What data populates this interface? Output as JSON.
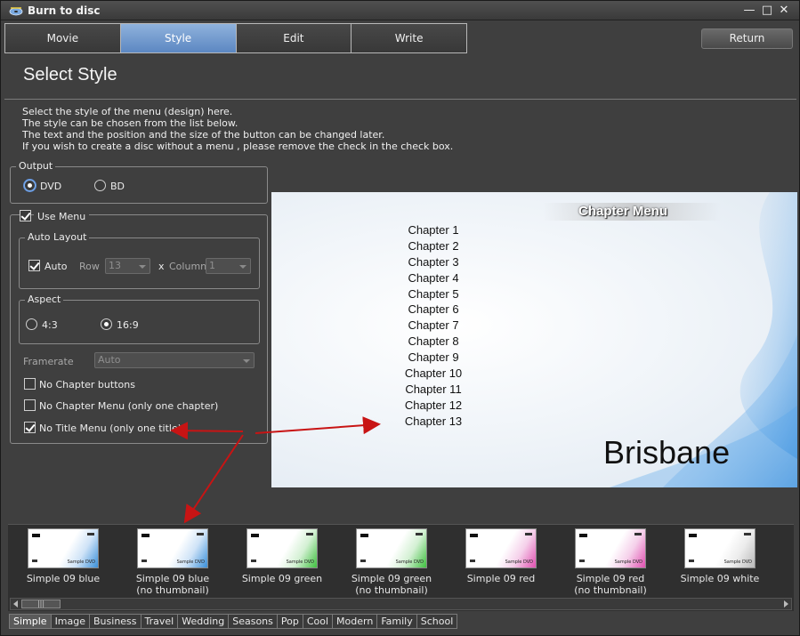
{
  "window": {
    "title": "Burn to disc"
  },
  "tabs": [
    {
      "label": "Movie",
      "active": false
    },
    {
      "label": "Style",
      "active": true
    },
    {
      "label": "Edit",
      "active": false
    },
    {
      "label": "Write",
      "active": false
    }
  ],
  "return_label": "Return",
  "page_title": "Select Style",
  "description": [
    "Select the style of the menu (design) here.",
    "The style can be chosen from the list below.",
    "The text and the position and the size of the button can be changed later.",
    "If you wish to create a disc without a menu , please remove the check in the check box."
  ],
  "output": {
    "label": "Output",
    "options": [
      {
        "label": "DVD",
        "checked": true
      },
      {
        "label": "BD",
        "checked": false
      }
    ]
  },
  "use_menu": {
    "label": "Use Menu",
    "checked": true
  },
  "auto_layout": {
    "label": "Auto Layout",
    "auto_label": "Auto",
    "auto_checked": true,
    "row_label": "Row",
    "row_value": "13",
    "x_label": "x",
    "column_label": "Column",
    "column_value": "1"
  },
  "aspect": {
    "label": "Aspect",
    "options": [
      {
        "label": "4:3",
        "checked": false
      },
      {
        "label": "16:9",
        "checked": true
      }
    ]
  },
  "framerate": {
    "label": "Framerate",
    "value": "Auto"
  },
  "options": [
    {
      "label": "No Chapter buttons",
      "checked": false
    },
    {
      "label": "No Chapter Menu (only one chapter)",
      "checked": false
    },
    {
      "label": "No Title Menu (only one title)",
      "checked": true
    }
  ],
  "preview": {
    "header": "Chapter Menu",
    "chapters": [
      "Chapter 1",
      "Chapter 2",
      "Chapter 3",
      "Chapter 4",
      "Chapter 5",
      "Chapter 6",
      "Chapter 7",
      "Chapter 8",
      "Chapter 9",
      "Chapter 10",
      "Chapter 11",
      "Chapter 12",
      "Chapter 13"
    ],
    "place_name": "Brisbane"
  },
  "thumb_badge": "Sample DVD",
  "styles": [
    {
      "name": "Simple 09 blue",
      "sub": "",
      "accent": "#3a8fd8"
    },
    {
      "name": "Simple 09 blue",
      "sub": "(no thumbnail)",
      "accent": "#3a8fd8"
    },
    {
      "name": "Simple 09 green",
      "sub": "",
      "accent": "#3fbf3f"
    },
    {
      "name": "Simple 09 green",
      "sub": "(no thumbnail)",
      "accent": "#3fbf3f"
    },
    {
      "name": "Simple 09 red",
      "sub": "",
      "accent": "#e04fb0"
    },
    {
      "name": "Simple 09 red",
      "sub": "(no thumbnail)",
      "accent": "#e04fb0"
    },
    {
      "name": "Simple 09 white",
      "sub": "",
      "accent": "#b8b8b8"
    }
  ],
  "scroll_thumb_label": "|||",
  "categories": [
    {
      "label": "Simple",
      "active": true
    },
    {
      "label": "Image",
      "active": false
    },
    {
      "label": "Business",
      "active": false
    },
    {
      "label": "Travel",
      "active": false
    },
    {
      "label": "Wedding",
      "active": false
    },
    {
      "label": "Seasons",
      "active": false
    },
    {
      "label": "Pop",
      "active": false
    },
    {
      "label": "Cool",
      "active": false
    },
    {
      "label": "Modern",
      "active": false
    },
    {
      "label": "Family",
      "active": false
    },
    {
      "label": "School",
      "active": false
    }
  ],
  "colors": {
    "accent": "#5c87c2",
    "annotation": "#c81414"
  }
}
